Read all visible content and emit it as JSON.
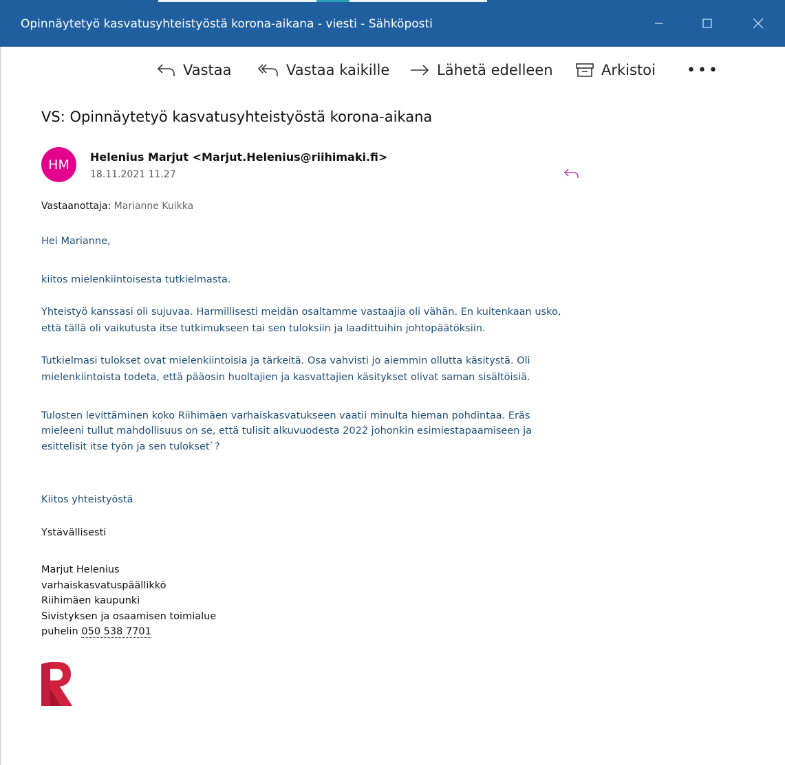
{
  "window": {
    "title": "Opinnäytetyö kasvatusyhteistyöstä korona-aikana - viesti - Sähköposti"
  },
  "toolbar": {
    "reply_label": "Vastaa",
    "reply_all_label": "Vastaa kaikille",
    "forward_label": "Lähetä edelleen",
    "archive_label": "Arkistoi",
    "more_label": "•••"
  },
  "message": {
    "subject": "VS: Opinnäytetyö kasvatusyhteistyöstä korona-aikana",
    "avatar_initials": "HM",
    "sender": "Helenius Marjut <Marjut.Helenius@riihimaki.fi>",
    "date": "18.11.2021 11.27",
    "recipient_label": "Vastaanottaja:",
    "recipient_value": "Marianne Kuikka"
  },
  "body": {
    "greeting": "Hei Marianne,",
    "p1": "kiitos mielenkiintoisesta tutkielmasta.",
    "p2_l1": "Yhteistyö kanssasi oli sujuvaa. Harmillisesti meidän osaltamme vastaajia oli vähän. En kuitenkaan usko,",
    "p2_l2": "että tällä oli vaikutusta itse tutkimukseen tai sen tuloksiin ja laadittuihin johtopäätöksiin.",
    "p3_l1": "Tutkielmasi tulokset ovat mielenkiintoisia ja  tärkeitä. Osa vahvisti jo aiemmin ollutta käsitystä.  Oli",
    "p3_l2": "mielenkiintoista todeta, että pääosin huoltajien ja kasvattajien käsitykset olivat saman sisältöisiä.",
    "p4_l1": "Tulosten levittäminen koko Riihimäen varhaiskasvatukseen vaatii minulta hieman pohdintaa. Eräs",
    "p4_l2": "mieleeni tullut mahdollisuus on se, että tulisit alkuvuodesta 2022 johonkin esimiestapaamiseen ja",
    "p4_l3": "esittelisit itse työn ja sen tulokset`?",
    "thanks": "Kiitos yhteistyöstä",
    "regards": "Ystävällisesti"
  },
  "signature": {
    "name": "Marjut Helenius",
    "role": "varhaiskasvatuspäällikkö",
    "org": "Riihimäen kaupunki",
    "dept": "Sivistyksen ja osaamisen toimialue",
    "phone_label": "puhelin",
    "phone": "050 538 7701"
  },
  "colors": {
    "titlebar": "#1f5fa0",
    "avatar": "#e3008c",
    "body_text": "#1f4e79",
    "logo": "#d2213f"
  }
}
